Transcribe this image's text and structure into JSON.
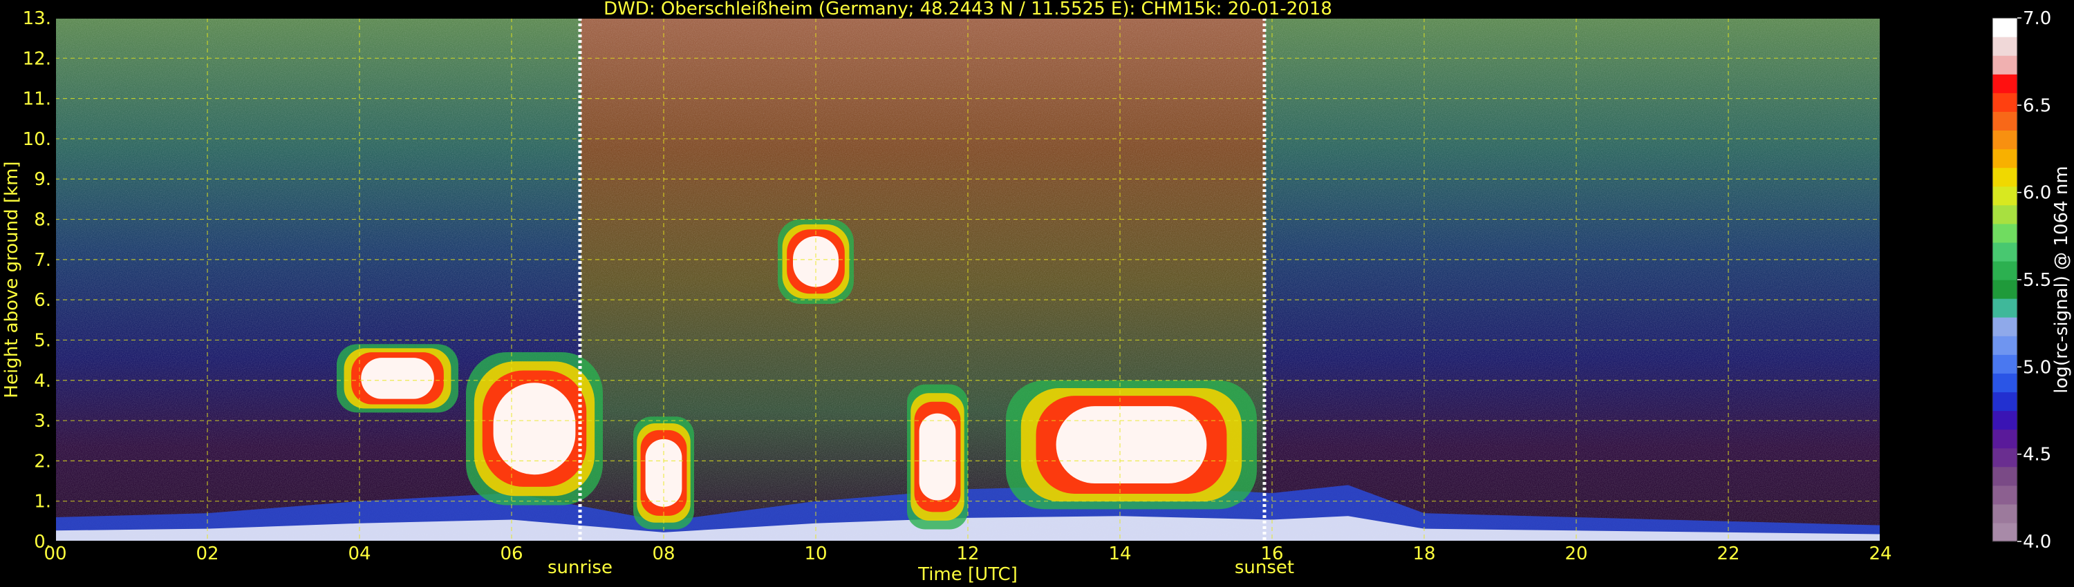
{
  "chart_data": {
    "type": "heatmap",
    "title": "DWD: Oberschleißheim (Germany; 48.2443 N / 11.5525 E):    CHM15k: 20-01-2018",
    "xlabel": "Time [UTC]",
    "ylabel": "Height above ground [km]",
    "xlim": [
      0,
      24
    ],
    "ylim": [
      0,
      13
    ],
    "x_ticks": [
      "00",
      "02",
      "04",
      "06",
      "08",
      "10",
      "12",
      "14",
      "16",
      "18",
      "20",
      "22",
      "24"
    ],
    "y_ticks": [
      "0.",
      "1.",
      "2.",
      "3.",
      "4.",
      "5.",
      "6.",
      "7.",
      "8.",
      "9.",
      "10.",
      "11.",
      "12.",
      "13."
    ],
    "grid": true,
    "markers": [
      {
        "label": "sunrise",
        "x": 6.9
      },
      {
        "label": "sunset",
        "x": 15.9
      }
    ],
    "colorbar": {
      "label": "log(rc-signal) @ 1064 nm",
      "range": [
        4.0,
        7.0
      ],
      "ticks": [
        "4.0",
        "4.5",
        "5.0",
        "5.5",
        "6.0",
        "6.5",
        "7.0"
      ],
      "colors": [
        "#a88aa8",
        "#9c7a9c",
        "#8c6090",
        "#7a4a86",
        "#6a2e90",
        "#5a1a9a",
        "#3a14b4",
        "#2230d0",
        "#2a55e6",
        "#4a78f0",
        "#6f95f0",
        "#8fa9ea",
        "#3fb89a",
        "#1f9a3a",
        "#2cb050",
        "#48c870",
        "#70dc60",
        "#a8e040",
        "#d8e820",
        "#f0d800",
        "#f8b000",
        "#f89010",
        "#f86818",
        "#ff4010",
        "#ff1010",
        "#f0b0b0",
        "#f0d8d8",
        "#ffffff"
      ]
    },
    "cloud_layers": [
      {
        "t0": 3.7,
        "t1": 5.3,
        "base": 3.2,
        "top": 4.9
      },
      {
        "t0": 5.4,
        "t1": 7.2,
        "base": 0.9,
        "top": 4.7
      },
      {
        "t0": 7.6,
        "t1": 8.4,
        "base": 0.3,
        "top": 3.1
      },
      {
        "t0": 9.5,
        "t1": 10.5,
        "base": 5.9,
        "top": 8.0
      },
      {
        "t0": 11.2,
        "t1": 12.0,
        "base": 0.3,
        "top": 3.9
      },
      {
        "t0": 12.5,
        "t1": 15.8,
        "base": 0.8,
        "top": 4.0
      }
    ],
    "boundary_layer": [
      {
        "t": 0,
        "h": 0.6
      },
      {
        "t": 2,
        "h": 0.7
      },
      {
        "t": 4,
        "h": 1.0
      },
      {
        "t": 6,
        "h": 1.2
      },
      {
        "t": 8,
        "h": 0.5
      },
      {
        "t": 10,
        "h": 1.0
      },
      {
        "t": 12,
        "h": 1.3
      },
      {
        "t": 14,
        "h": 1.4
      },
      {
        "t": 16,
        "h": 1.2
      },
      {
        "t": 17,
        "h": 1.4
      },
      {
        "t": 18,
        "h": 0.7
      },
      {
        "t": 20,
        "h": 0.6
      },
      {
        "t": 22,
        "h": 0.5
      },
      {
        "t": 24,
        "h": 0.4
      }
    ]
  }
}
